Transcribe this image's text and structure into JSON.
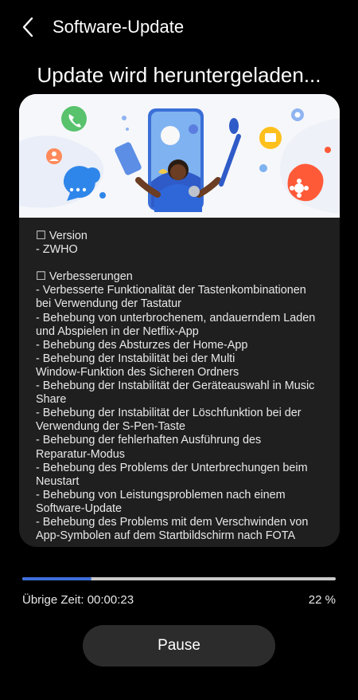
{
  "header": {
    "title": "Software-Update",
    "back_icon": "chevron-left-icon"
  },
  "headline": "Update wird heruntergeladen...",
  "release_notes": [
    "☐ Version",
    "- ZWHO",
    "",
    "☐ Verbesserungen",
    "- Verbesserte Funktionalität der Tastenkombinationen",
    "bei Verwendung der Tastatur",
    "- Behebung von unterbrochenem, andauerndem Laden",
    "und Abspielen in der Netflix-App",
    "- Behebung des Absturzes der Home-App",
    "- Behebung der Instabilität bei der Multi",
    "Window-Funktion des Sicheren Ordners",
    "- Behebung der Instabilität der Geräteauswahl in Music",
    "Share",
    "- Behebung der Instabilität der Löschfunktion bei der",
    "Verwendung der S-Pen-Taste",
    "- Behebung der fehlerhaften Ausführung des",
    "Reparatur-Modus",
    "- Behebung des Problems der Unterbrechungen beim",
    "Neustart",
    "- Behebung von Leistungsproblemen nach einem",
    "Software-Update",
    "- Behebung des Problems mit dem Verschwinden von",
    "App-Symbolen auf dem Startbildschirm nach FOTA"
  ],
  "progress": {
    "fraction": 0.22,
    "remaining_label": "Übrige Zeit: 00:00:23",
    "percent_label": "22 %"
  },
  "pause_button": {
    "label": "Pause"
  },
  "colors": {
    "background": "#000000",
    "card": "#1f1f1f",
    "progress_fill": "#3e6fdc",
    "progress_track": "#c9c9c9",
    "button": "#2c2c2c"
  }
}
